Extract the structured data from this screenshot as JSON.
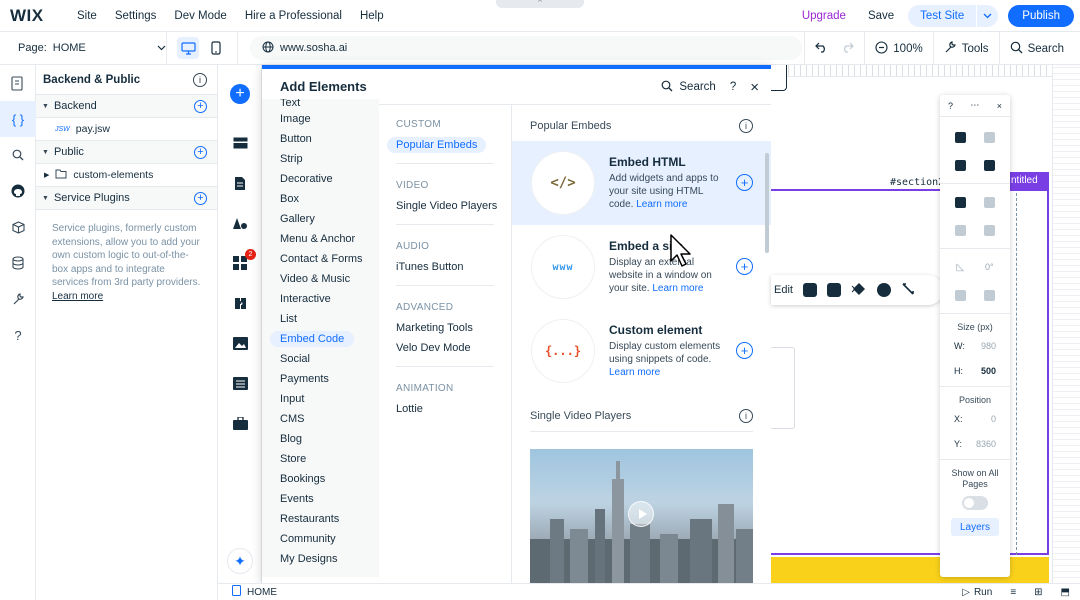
{
  "topbar": {
    "logo": "WIX",
    "nav": [
      "Site",
      "Settings",
      "Dev Mode",
      "Hire a Professional",
      "Help"
    ],
    "upgrade": "Upgrade",
    "save": "Save",
    "test_site": "Test Site",
    "publish": "Publish",
    "notch": "^"
  },
  "bar2": {
    "page_label": "Page:",
    "page_value": "HOME",
    "url": "www.sosha.ai",
    "zoom": "100%",
    "tools": "Tools",
    "search": "Search"
  },
  "code_panel": {
    "title": "Backend & Public",
    "backend_label": "Backend",
    "file_tag": "JSW",
    "file_name": "pay.jsw",
    "public_label": "Public",
    "folder_name": "custom-elements",
    "service_plugins_label": "Service Plugins",
    "description": "Service plugins, formerly custom extensions, allow you to add your own custom logic to out-of-the-box apps and to integrate services from 3rd party providers.",
    "learn_more": "Learn more"
  },
  "add_strip": {
    "badge_count": "2"
  },
  "add_panel": {
    "title": "Add Elements",
    "search": "Search",
    "help": "?",
    "close": "×",
    "categories": [
      "Text",
      "Image",
      "Button",
      "Strip",
      "Decorative",
      "Box",
      "Gallery",
      "Menu & Anchor",
      "Contact & Forms",
      "Video & Music",
      "Interactive",
      "List",
      "Embed Code",
      "Social",
      "Payments",
      "Input",
      "CMS",
      "Blog",
      "Store",
      "Bookings",
      "Events",
      "Restaurants",
      "Community",
      "My Designs"
    ],
    "selected_category": "Embed Code",
    "subcategories": {
      "custom_head": "CUSTOM",
      "custom_items": [
        "Popular Embeds"
      ],
      "video_head": "VIDEO",
      "video_items": [
        "Single Video Players"
      ],
      "audio_head": "AUDIO",
      "audio_items": [
        "iTunes Button"
      ],
      "advanced_head": "ADVANCED",
      "advanced_items": [
        "Marketing Tools",
        "Velo Dev Mode"
      ],
      "animation_head": "ANIMATION",
      "animation_items": [
        "Lottie"
      ]
    },
    "content": {
      "popular_head": "Popular Embeds",
      "cards": [
        {
          "title": "Embed HTML",
          "desc": "Add widgets and apps to your site using HTML code.",
          "link": "Learn more",
          "glyph": "</>",
          "glyph_color": "#7a6a3a"
        },
        {
          "title": "Embed a site",
          "desc": "Display an external website in a window on your site.",
          "link": "Learn more",
          "glyph": "www",
          "glyph_color": "#3899ec"
        },
        {
          "title": "Custom element",
          "desc": "Display custom elements using snippets of code.",
          "link": "Learn more",
          "glyph": "{...}",
          "glyph_color": "#e8512b"
        }
      ],
      "video_head": "Single Video Players"
    }
  },
  "canvas": {
    "section_label": "#section2",
    "untitled_tab": "ntitled",
    "edit": "Edit"
  },
  "inspector": {
    "help": "?",
    "size_label": "Size (px)",
    "w_label": "W:",
    "w_value": "980",
    "h_label": "H:",
    "h_value": "500",
    "rotation": "0°",
    "position_label": "Position",
    "x_label": "X:",
    "x_value": "0",
    "y_label": "Y:",
    "y_value": "8360",
    "show_all_pages": "Show on All Pages",
    "layers": "Layers"
  },
  "bottombar": {
    "page": "HOME",
    "run": "Run"
  },
  "colors": {
    "accent": "#116dff",
    "upgrade": "#9a27d5",
    "section_outline": "#7a3fe4",
    "yellow": "#f9d11b"
  }
}
